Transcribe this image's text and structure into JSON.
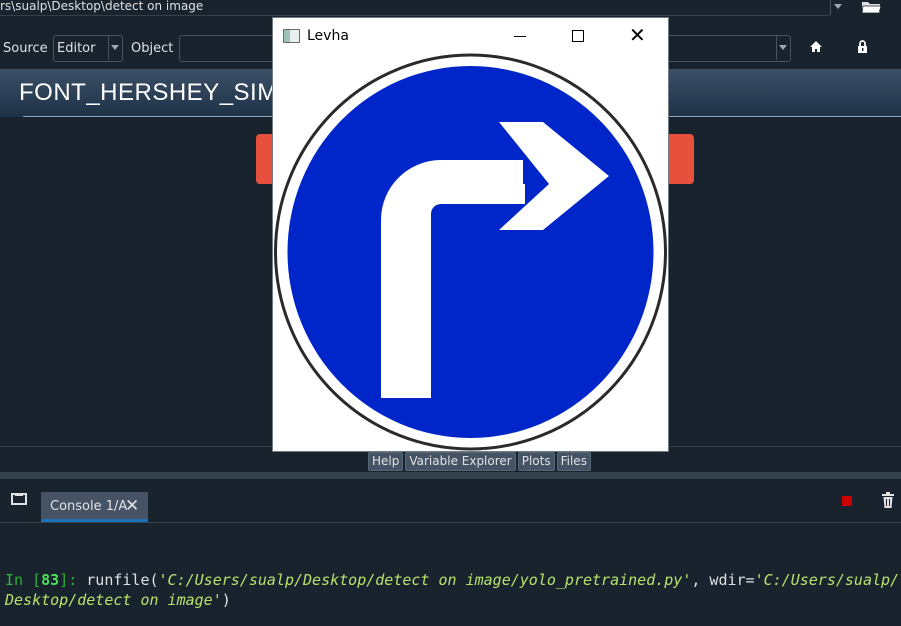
{
  "pathbar": {
    "path": "rs\\sualp\\Desktop\\detect on image"
  },
  "toolbar": {
    "source_label": "Source",
    "source_value": "Editor",
    "object_label": "Object",
    "object_value": ""
  },
  "help": {
    "title": "FONT_HERSHEY_SIMP"
  },
  "pane_tabs": [
    "Help",
    "Variable Explorer",
    "Plots",
    "Files"
  ],
  "console": {
    "tab_label": "Console 1/A",
    "close_glyph": "✕",
    "prompt_in": "In [",
    "prompt_num": "83",
    "prompt_end": "]: ",
    "cmd": "runfile(",
    "arg1": "'C:/Users/sualp/Desktop/detect on image/yolo_pretrained.py'",
    "sep": ", wdir=",
    "arg2a": "'C:/Users/sualp/",
    "arg2b": "Desktop/detect on image'",
    "close_paren": ")"
  },
  "cv_window": {
    "title": "Levha",
    "close_glyph": "✕"
  },
  "colors": {
    "background": "#19232d",
    "sign_blue": "#0026c9",
    "accent_red": "#e8503e",
    "prompt_green": "#49e35a"
  }
}
